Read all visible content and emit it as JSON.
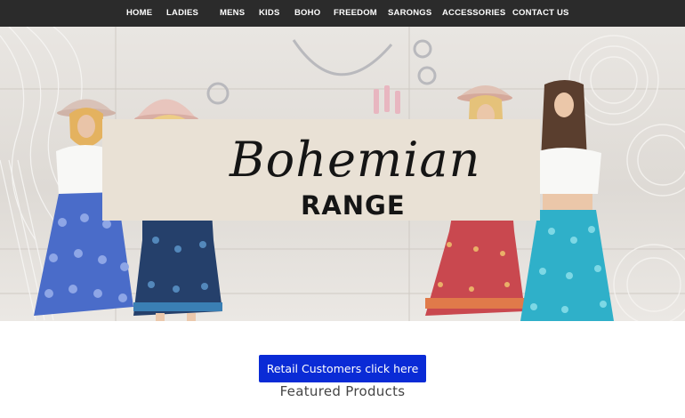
{
  "nav": {
    "items": [
      "HOME",
      "LADIES",
      "MENS",
      "KIDS",
      "BOHO",
      "FREEDOM",
      "SARONGS",
      "ACCESSORIES",
      "CONTACT US"
    ]
  },
  "hero": {
    "title_script": "Bohemian",
    "title_sub": "RANGE",
    "colors": {
      "band": "#e9e1d5",
      "text": "#151515"
    }
  },
  "cta": {
    "label": "Retail Customers click here",
    "color": "#0a2bd6"
  },
  "featured": {
    "heading": "Featured Products"
  }
}
